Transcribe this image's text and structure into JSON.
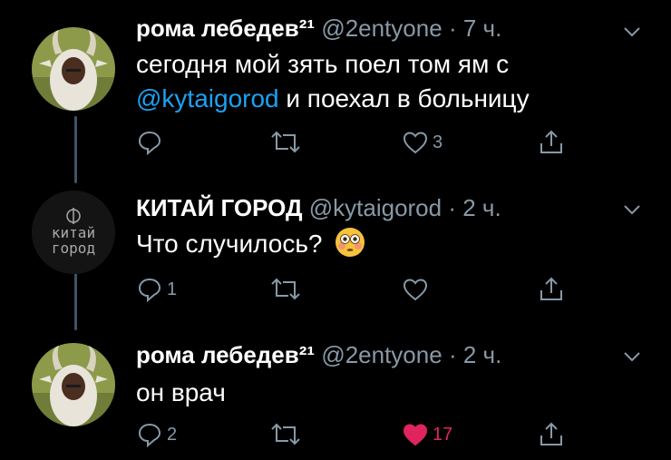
{
  "tweets": [
    {
      "author_name": "рома лебедев²¹",
      "handle": "@2entyone",
      "separator": "·",
      "time": "7 ч.",
      "text_parts": [
        "сегодня мой зять поел том ям с",
        "@kytaigorod",
        "и поехал в больницу"
      ],
      "actions": {
        "reply_count": "",
        "retweet_count": "",
        "like_count": "3",
        "liked": false
      }
    },
    {
      "author_name": "КИТАЙ ГОРОД",
      "handle": "@kytaigorod",
      "separator": "·",
      "time": "2 ч.",
      "avatar_text": [
        "китай",
        "город"
      ],
      "text": "Что случилось?",
      "emoji": "flushed-face",
      "actions": {
        "reply_count": "1",
        "retweet_count": "",
        "like_count": "",
        "liked": false
      }
    },
    {
      "author_name": "рома лебедев²¹",
      "handle": "@2entyone",
      "separator": "·",
      "time": "2 ч.",
      "text": "он врач",
      "actions": {
        "reply_count": "2",
        "retweet_count": "",
        "like_count": "17",
        "liked": true
      }
    }
  ],
  "colors": {
    "background": "#000000",
    "text": "#ffffff",
    "secondary": "#8899a6",
    "link": "#1da1f2",
    "like": "#e0245e",
    "thread_line": "#3d5466"
  }
}
